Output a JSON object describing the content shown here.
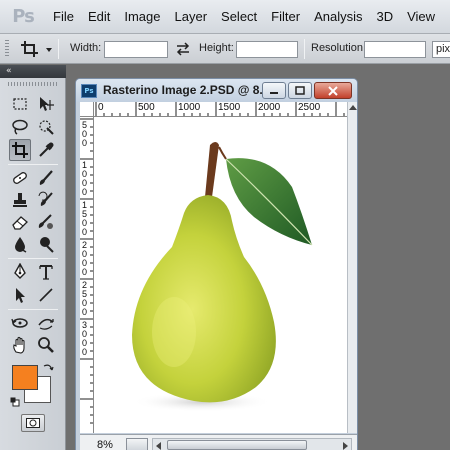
{
  "app": {
    "logo_text": "Ps",
    "menu": [
      "File",
      "Edit",
      "Image",
      "Layer",
      "Select",
      "Filter",
      "Analysis",
      "3D",
      "View"
    ]
  },
  "options_bar": {
    "tool_icon": "crop-icon",
    "width_label": "Width:",
    "width_value": "",
    "swap_icon": "swap-dimensions-icon",
    "height_label": "Height:",
    "height_value": "",
    "resolution_label": "Resolution:",
    "resolution_value": "",
    "resolution_unit": "pixels/inch"
  },
  "tools_panel": {
    "collapse_glyph": "«",
    "active_tool": "crop-tool",
    "tools": [
      "rectangular-marquee-tool",
      "move-tool",
      "lasso-tool",
      "quick-selection-tool",
      "crop-tool",
      "eyedropper-tool",
      "spot-healing-brush-tool",
      "brush-tool",
      "clone-stamp-tool",
      "history-brush-tool",
      "eraser-tool",
      "gradient-tool",
      "blur-tool",
      "dodge-tool",
      "pen-tool",
      "type-tool",
      "path-selection-tool",
      "line-tool",
      "3d-rotate-tool",
      "3d-orbit-tool",
      "hand-tool",
      "zoom-tool"
    ],
    "foreground_color": "#f5801f",
    "background_color": "#ffffff"
  },
  "document": {
    "title": "Rasterino Image 2.PSD @ 8...",
    "ruler_h_labels": [
      "0",
      "500",
      "1000",
      "1500",
      "2000",
      "2500"
    ],
    "ruler_v_labels": [
      "500",
      "1000",
      "1500",
      "2000",
      "2500",
      "3000"
    ],
    "zoom": "8%",
    "image_subject": "pear-with-leaf"
  }
}
